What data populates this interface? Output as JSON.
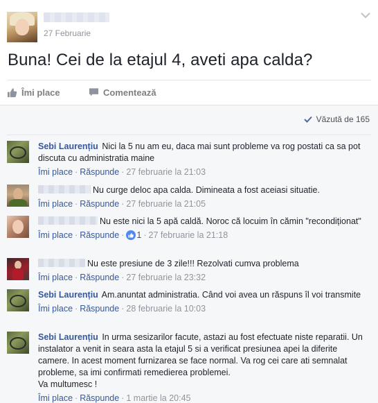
{
  "post": {
    "date": "27 Februarie",
    "text": "Buna! Cei de la etajul 4, aveti apa calda?",
    "like_label": "Îmi place",
    "comment_label": "Comentează"
  },
  "seen": {
    "label": "Văzută de 165"
  },
  "comment_actions": {
    "like": "Îmi place",
    "reply": "Răspunde"
  },
  "comments": [
    {
      "name": "Sebi Laurențiu",
      "text": "Nici la 5 nu am eu, daca mai sunt probleme va rog postati ca sa pot discuta cu administratia maine",
      "time": "27 februarie la 21:03"
    },
    {
      "name": "",
      "text": "Nu curge deloc apa calda. Dimineata a fost aceiasi situatie.",
      "time": "27 februarie la 21:05"
    },
    {
      "name": "",
      "text": "Nu este nici la 5 apă caldă. Noroc că locuim în cămin \"recondiționat\"",
      "time": "27 februarie la 21:18",
      "reactions": "1"
    },
    {
      "name": "",
      "text": "Nu este presiune de 3 zile!!! Rezolvati cumva problema",
      "time": "27 februarie la 23:32"
    },
    {
      "name": "Sebi Laurențiu",
      "text": "Am.anuntat administratia. Când voi avea un răspuns îl voi transmite",
      "time": "28 februarie la 10:03"
    },
    {
      "name": "Sebi Laurențiu",
      "text": "In urma sesizarilor facute, astazi au fost efectuate niste reparatii. Un instalator a venit in seara asta la etajul 5 si a verificat presiunea apei la diferite camere. In acest moment furnizarea se face normal. Va rog cei care ati semnalat probleme, sa imi confirmati remedierea problemei.",
      "text2": "Va multumesc !",
      "time": "1 martie la 20:45"
    }
  ],
  "colors": {
    "link": "#365899",
    "meta": "#90949c",
    "comments_bg": "#f6f7f9",
    "like_reaction": "#4e88f5"
  },
  "icons": [
    "thumbs-up-icon",
    "comment-bubble-icon",
    "checkmark-icon",
    "chevron-down-icon",
    "like-reaction-icon"
  ]
}
